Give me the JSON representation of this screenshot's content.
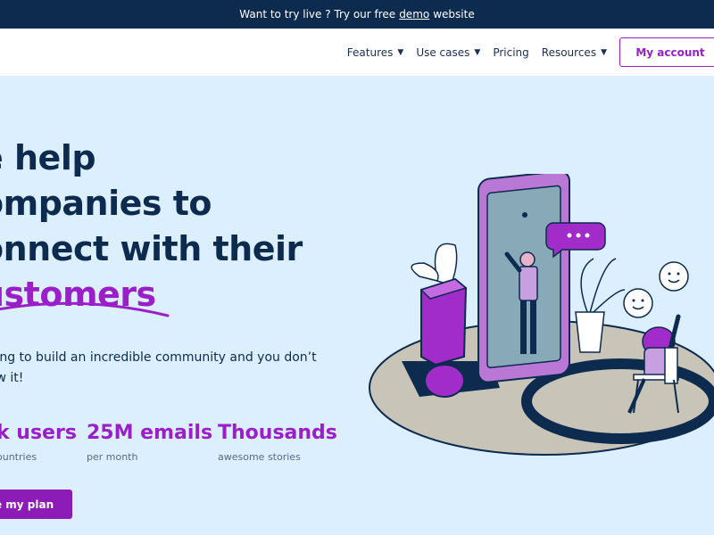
{
  "topbar": {
    "text_before": "Want to try live ? Try our free",
    "link": "demo",
    "text_after": "website"
  },
  "nav": {
    "items": [
      {
        "label": "Features",
        "has_dropdown": true
      },
      {
        "label": "Use cases",
        "has_dropdown": true
      },
      {
        "label": "Pricing",
        "has_dropdown": false
      },
      {
        "label": "Resources",
        "has_dropdown": true
      }
    ],
    "account_button": "My account"
  },
  "hero": {
    "line1": "e help",
    "line2": "ompanies to",
    "line3": "onnect with their",
    "line4": "ustomers"
  },
  "subtitle": {
    "line1": "going to build an incredible community and you don’t",
    "line2": "now it!"
  },
  "stats": [
    {
      "value": "k users",
      "label": "ountries"
    },
    {
      "value": "25M emails",
      "label": "per month"
    },
    {
      "value": "Thousands",
      "label": "awesome stories"
    }
  ],
  "cta": "se my plan",
  "colors": {
    "accent": "#9a1fc8",
    "navy": "#0d2a4f",
    "background": "#dcefff"
  }
}
